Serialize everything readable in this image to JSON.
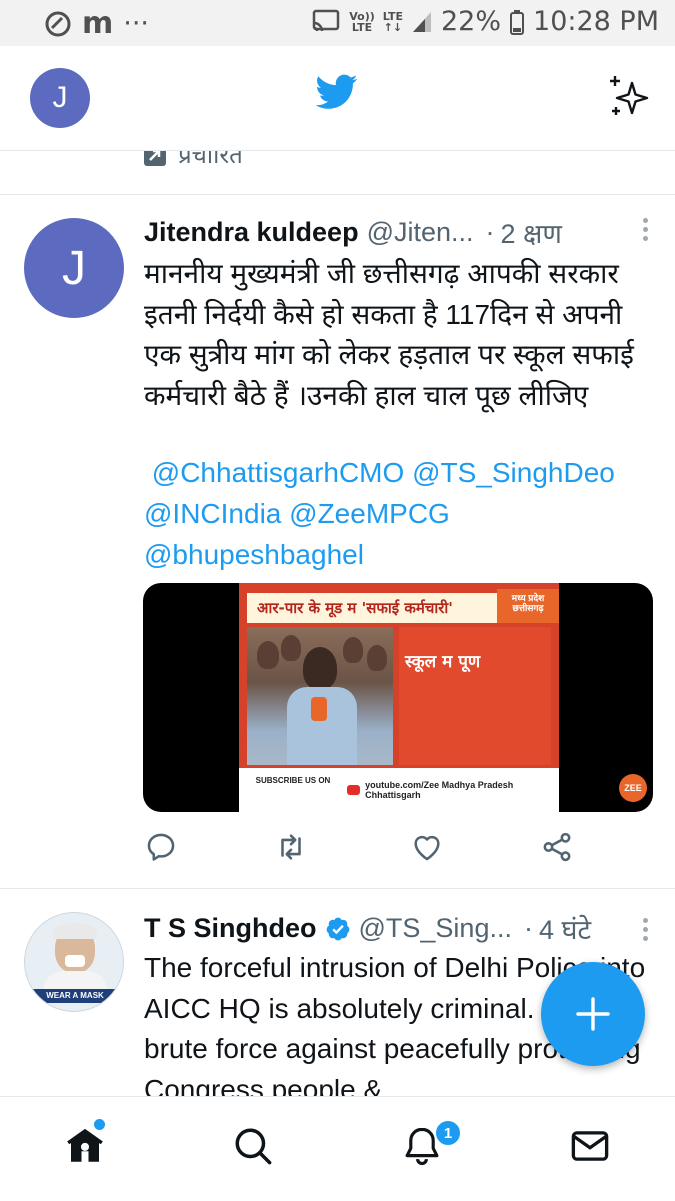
{
  "status_bar": {
    "network_label_1": "Vo))",
    "network_label_2": "LTE",
    "lte_label": "LTE",
    "battery": "22%",
    "time": "10:28 PM",
    "app_letter": "m",
    "more": "···"
  },
  "header": {
    "avatar_letter": "J",
    "logo_icon": "twitter-bird-icon",
    "sparkle_icon": "sparkle-icon"
  },
  "promoted_label": "प्रचारित",
  "tweet1": {
    "avatar_letter": "J",
    "name": "Jitendra kuldeep",
    "handle": "@Jiten...",
    "separator": "·",
    "time": "2 क्षण",
    "text": "माननीय मुख्यमंत्री जी छत्तीसगढ़ आपकी सरकार इतनी निर्दयी कैसे हो सकता है 117दिन से अपनी एक सुत्रीय मांग को लेकर हड़ताल पर स्कूल सफाई कर्मचारी बैठे हैं ।उनकी हाल चाल पूछ लीजिए",
    "mentions": [
      "@ChhattisgarhCMO",
      "@TS_SinghDeo",
      "@INCIndia",
      "@ZeeMPCG",
      "@bhupeshbaghel"
    ],
    "media": {
      "banner": "आर-पार के मूड म 'सफाई कर्मचारी'",
      "side_text": "स्कूल म पूण",
      "zee_box": "मध्य प्रदेश छत्तीसगढ़",
      "subscribe": "SUBSCRIBE US ON",
      "youtube": "youtube.com/Zee Madhya Pradesh Chhattisgarh",
      "corner_logo": "ZEE"
    }
  },
  "tweet2": {
    "name": "T S Singhdeo",
    "verified_icon": "verified-badge-icon",
    "handle": "@TS_Sing...",
    "separator": "·",
    "time": "4 घंटे",
    "text": "The forceful intrusion of Delhi Police into AICC HQ is absolutely criminal. Use of brute force against peacefully protesting Congress people &",
    "avatar_caption": "WEAR A MASK"
  },
  "nav": {
    "notifications_badge": "1"
  }
}
